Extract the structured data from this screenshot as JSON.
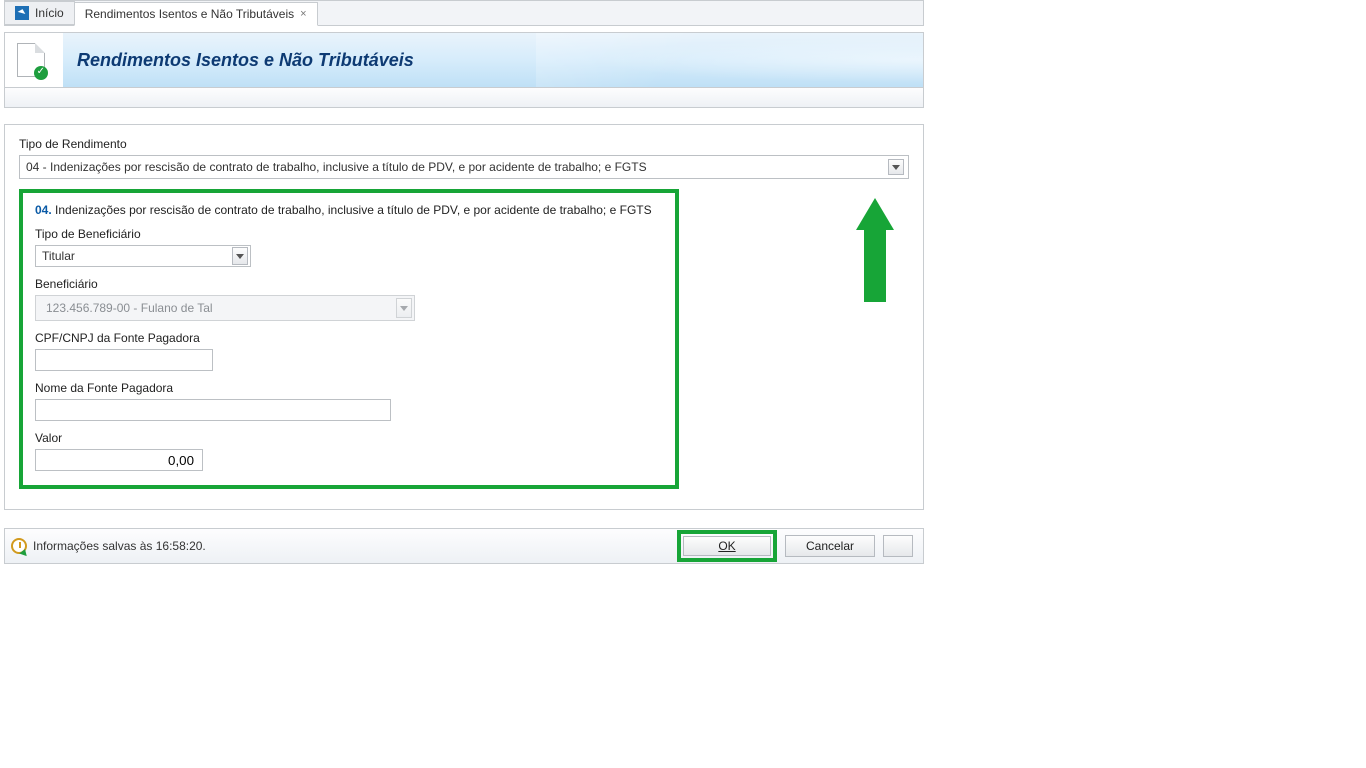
{
  "tabs": {
    "inicio": "Início",
    "rend": "Rendimentos Isentos e Não Tributáveis"
  },
  "header": {
    "title": "Rendimentos Isentos e Não Tributáveis"
  },
  "form": {
    "tipo_rend_label": "Tipo de Rendimento",
    "tipo_rend_value": "04 - Indenizações por rescisão de contrato de trabalho, inclusive a título de PDV, e por acidente de trabalho; e FGTS",
    "section_num": "04.",
    "section_desc": "Indenizações por rescisão de contrato de trabalho, inclusive a título de PDV, e por acidente de trabalho; e FGTS",
    "tipo_benef_label": "Tipo de Beneficiário",
    "tipo_benef_value": "Titular",
    "benef_label": "Beneficiário",
    "benef_value": "123.456.789-00 - Fulano de Tal",
    "cpf_label": "CPF/CNPJ da Fonte Pagadora",
    "cpf_value": "",
    "nome_fonte_label": "Nome da Fonte Pagadora",
    "nome_fonte_value": "",
    "valor_label": "Valor",
    "valor_value": "0,00"
  },
  "footer": {
    "status": "Informações salvas às 16:58:20.",
    "ok": "OK",
    "cancel": "Cancelar"
  }
}
